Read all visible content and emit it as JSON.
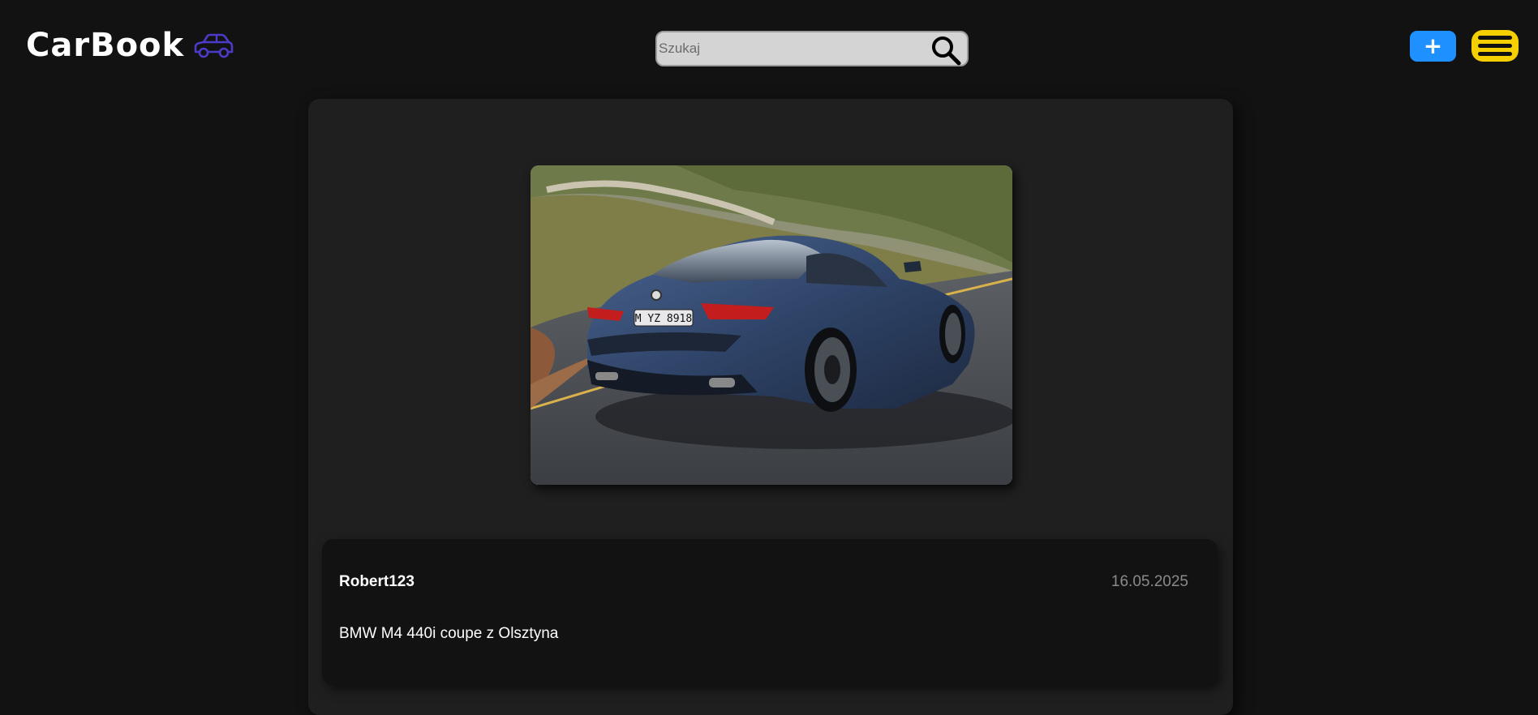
{
  "header": {
    "logo_text": "CarBook",
    "logo_icon": "car-icon",
    "search_placeholder": "Szukaj",
    "search_value": "",
    "search_icon": "search-icon",
    "add_label": "+",
    "menu_icon": "hamburger-menu-icon",
    "colors": {
      "add_button": "#1e90ff",
      "menu_button": "#f5cf00",
      "logo_icon": "#4b3bc7"
    }
  },
  "post": {
    "photo_alt": "car-photo",
    "plate_text": "M YZ 8918",
    "author": "Robert123",
    "date": "16.05.2025",
    "description": "BMW M4 440i coupe z Olsztyna"
  }
}
